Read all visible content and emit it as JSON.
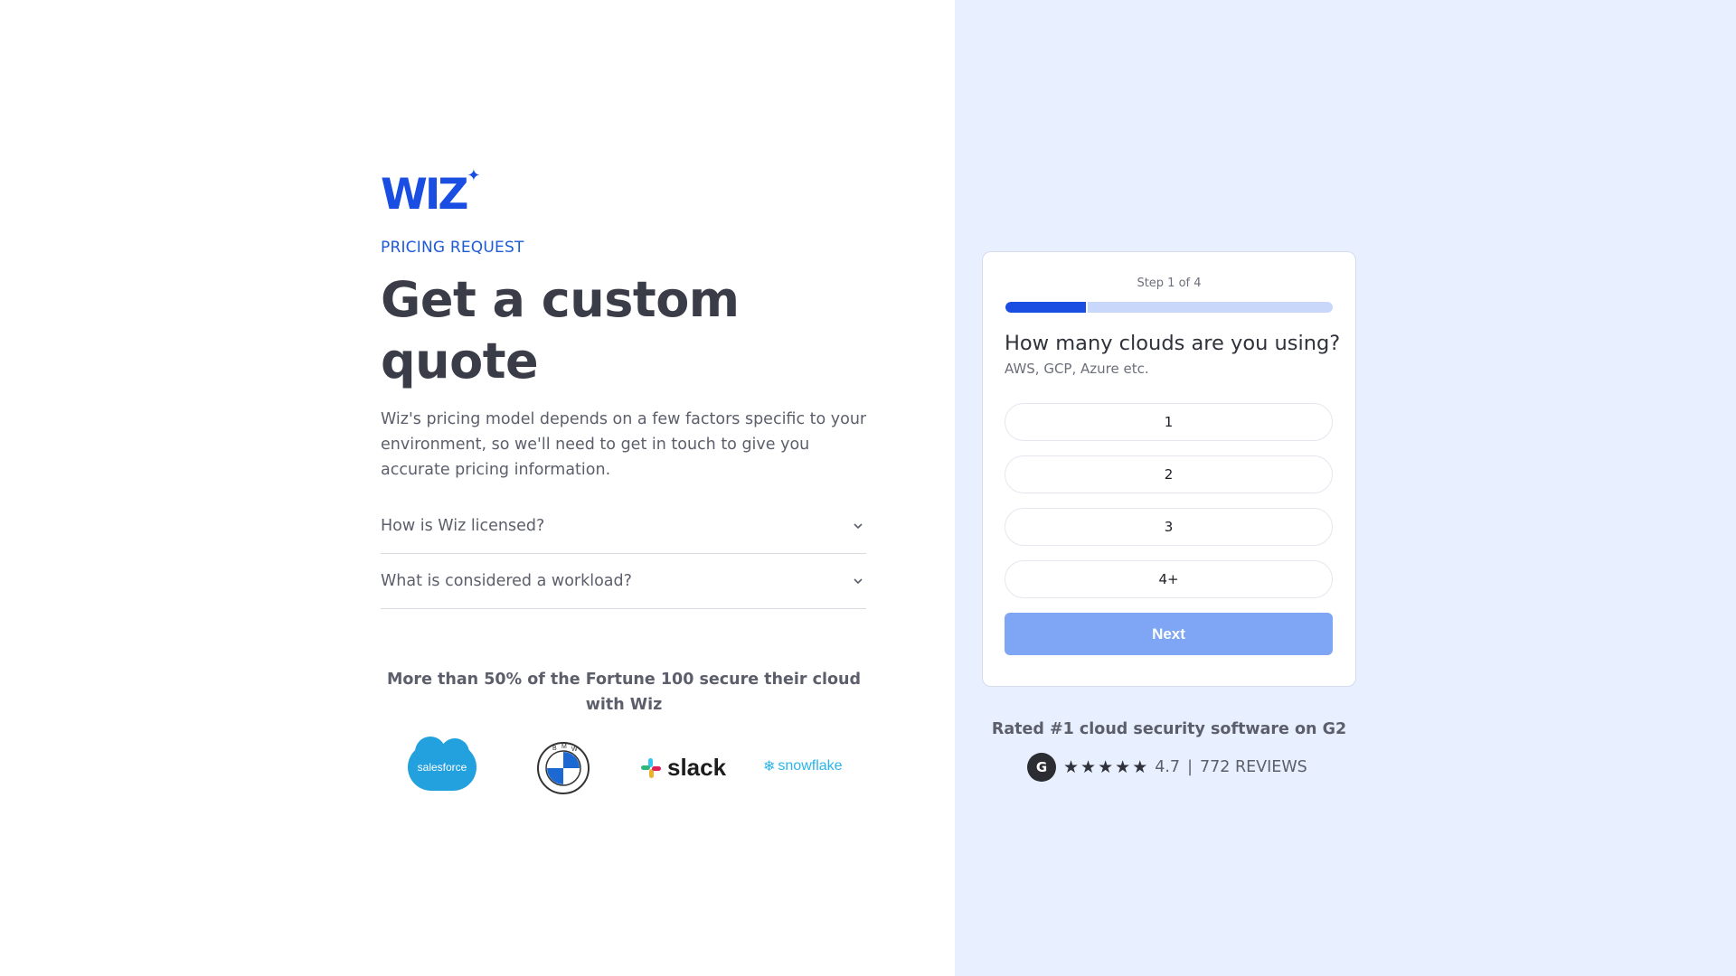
{
  "brand": {
    "logo_text": "WIZ"
  },
  "intro": {
    "eyebrow": "PRICING REQUEST",
    "headline": "Get a custom quote",
    "description": "Wiz's pricing model depends on a few factors specific to your environment, so we'll need to get in touch to give you accurate pricing information."
  },
  "faq": [
    {
      "question": "How is Wiz licensed?",
      "icon": "chevron-down-icon"
    },
    {
      "question": "What is considered a workload?",
      "icon": "chevron-down-icon"
    }
  ],
  "trust": {
    "text": "More than 50% of the Fortune 100 secure their cloud with Wiz",
    "logos": [
      {
        "name": "salesforce",
        "label": "salesforce"
      },
      {
        "name": "bmw",
        "label": "BMW"
      },
      {
        "name": "slack",
        "label": "slack"
      },
      {
        "name": "snowflake",
        "label": "snowflake"
      }
    ]
  },
  "form": {
    "step_label": "Step 1 of 4",
    "progress": 0.25,
    "question": "How many clouds are you using?",
    "subtext": "AWS, GCP, Azure etc.",
    "options": [
      "1",
      "2",
      "3",
      "4+"
    ],
    "next_label": "Next"
  },
  "rating": {
    "headline": "Rated #1 cloud security software on G2",
    "badge": "G",
    "stars": 5,
    "score": "4.7",
    "separator": "|",
    "reviews": "772 REVIEWS"
  },
  "colors": {
    "brand_blue": "#1a4de2",
    "right_panel_bg": "#e8effe",
    "next_button_bg": "#7ea6f4",
    "progress_track": "#c9d7fb"
  }
}
